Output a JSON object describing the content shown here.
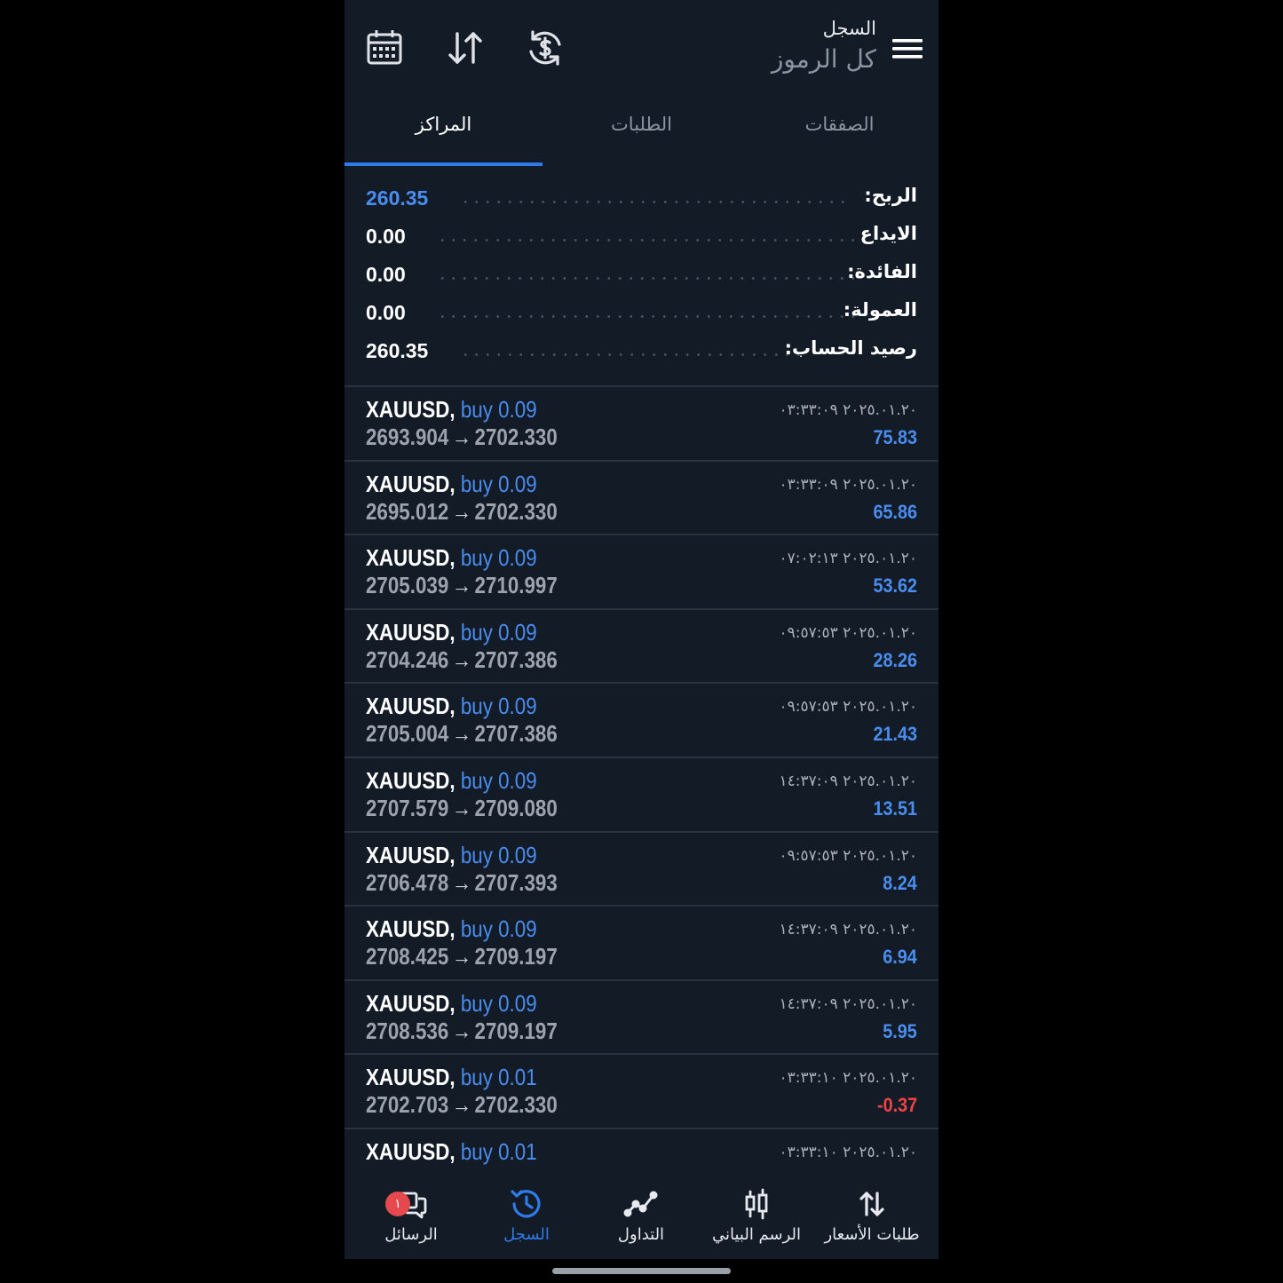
{
  "header": {
    "title_small": "السجل",
    "title_large": "كل الرموز",
    "icons": [
      "calendar-icon",
      "sort-icon",
      "currency-refresh-icon",
      "menu-icon"
    ]
  },
  "tabs": [
    {
      "label": "المراكز",
      "active": true
    },
    {
      "label": "الطلبات",
      "active": false
    },
    {
      "label": "الصفقات",
      "active": false
    }
  ],
  "summary": [
    {
      "label": "الربح:",
      "value": "260.35",
      "highlight": true
    },
    {
      "label": "الايداع",
      "value": "0.00",
      "highlight": false
    },
    {
      "label": "الفائدة:",
      "value": "0.00",
      "highlight": false
    },
    {
      "label": "العمولة:",
      "value": "0.00",
      "highlight": false
    },
    {
      "label": "رصيد الحساب:",
      "value": "260.35",
      "highlight": false
    }
  ],
  "deals": [
    {
      "symbol": "XAUUSD,",
      "side": "buy 0.09",
      "open": "2693.904",
      "close": "2702.330",
      "time": "٢٠٢٥.٠١.٢٠ ٠٣:٣٣:٠٩",
      "profit": "75.83",
      "negative": false
    },
    {
      "symbol": "XAUUSD,",
      "side": "buy 0.09",
      "open": "2695.012",
      "close": "2702.330",
      "time": "٢٠٢٥.٠١.٢٠ ٠٣:٣٣:٠٩",
      "profit": "65.86",
      "negative": false
    },
    {
      "symbol": "XAUUSD,",
      "side": "buy 0.09",
      "open": "2705.039",
      "close": "2710.997",
      "time": "٢٠٢٥.٠١.٢٠ ٠٧:٠٢:١٣",
      "profit": "53.62",
      "negative": false
    },
    {
      "symbol": "XAUUSD,",
      "side": "buy 0.09",
      "open": "2704.246",
      "close": "2707.386",
      "time": "٢٠٢٥.٠١.٢٠ ٠٩:٥٧:٥٣",
      "profit": "28.26",
      "negative": false
    },
    {
      "symbol": "XAUUSD,",
      "side": "buy 0.09",
      "open": "2705.004",
      "close": "2707.386",
      "time": "٢٠٢٥.٠١.٢٠ ٠٩:٥٧:٥٣",
      "profit": "21.43",
      "negative": false
    },
    {
      "symbol": "XAUUSD,",
      "side": "buy 0.09",
      "open": "2707.579",
      "close": "2709.080",
      "time": "٢٠٢٥.٠١.٢٠ ١٤:٣٧:٠٩",
      "profit": "13.51",
      "negative": false
    },
    {
      "symbol": "XAUUSD,",
      "side": "buy 0.09",
      "open": "2706.478",
      "close": "2707.393",
      "time": "٢٠٢٥.٠١.٢٠ ٠٩:٥٧:٥٣",
      "profit": "8.24",
      "negative": false
    },
    {
      "symbol": "XAUUSD,",
      "side": "buy 0.09",
      "open": "2708.425",
      "close": "2709.197",
      "time": "٢٠٢٥.٠١.٢٠ ١٤:٣٧:٠٩",
      "profit": "6.94",
      "negative": false
    },
    {
      "symbol": "XAUUSD,",
      "side": "buy 0.09",
      "open": "2708.536",
      "close": "2709.197",
      "time": "٢٠٢٥.٠١.٢٠ ١٤:٣٧:٠٩",
      "profit": "5.95",
      "negative": false
    },
    {
      "symbol": "XAUUSD,",
      "side": "buy 0.01",
      "open": "2702.703",
      "close": "2702.330",
      "time": "٢٠٢٥.٠١.٢٠ ٠٣:٣٣:١٠",
      "profit": "-0.37",
      "negative": true
    },
    {
      "symbol": "XAUUSD,",
      "side": "buy 0.01",
      "open": "",
      "close": "",
      "time": "٢٠٢٥.٠١.٢٠ ٠٣:٣٣:١٠",
      "profit": "",
      "negative": false
    }
  ],
  "arrow_glyph": "→",
  "bottom_nav": [
    {
      "label": "الرسائل",
      "icon": "chat-icon",
      "active": false,
      "badge": "١"
    },
    {
      "label": "السجل",
      "icon": "history-icon",
      "active": true
    },
    {
      "label": "التداول",
      "icon": "trend-icon",
      "active": false
    },
    {
      "label": "الرسم البياني",
      "icon": "candlestick-icon",
      "active": false
    },
    {
      "label": "طلبات الأسعار",
      "icon": "quotes-arrows-icon",
      "active": false
    }
  ],
  "colors": {
    "background": "#131b27",
    "accent": "#2f7bea",
    "profit": "#4a8df0",
    "loss": "#ef4444"
  }
}
